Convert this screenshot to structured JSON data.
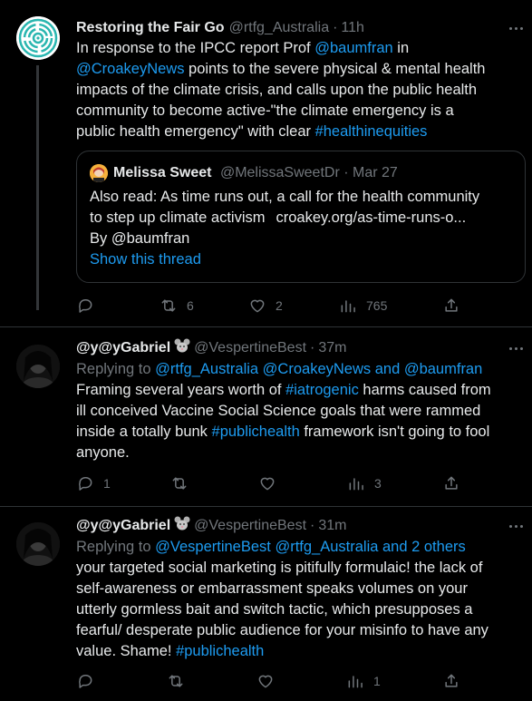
{
  "tweets": [
    {
      "name": "Restoring the Fair Go",
      "handle": "@rtfg_Australia",
      "sep": "·",
      "time": "11h",
      "text": {
        "l1_a": "In response to the IPCC report Prof ",
        "l1_link": "@baumfran",
        "l1_b": " in",
        "l2_link": "@CroakeyNews",
        "l2_b": " points to the severe physical & mental health",
        "l3": "impacts of the climate crisis, and calls upon the public health",
        "l4": "community to become active-\"the climate emergency is a",
        "l5_a": "public health emergency\" with clear ",
        "l5_link": "#healthinequities"
      },
      "quote": {
        "name": "Melissa Sweet",
        "handle": "@MelissaSweetDr",
        "sep": "·",
        "date": "Mar 27",
        "line1": "Also read: As time runs out, a call for the health community",
        "line2_a": "to step up climate activism",
        "line2_b": "croakey.org/as-time-runs-o...",
        "line3": "By @baumfran",
        "show_thread": "Show this thread"
      },
      "actions": {
        "reply": "",
        "retweet": "6",
        "like": "2",
        "views": "765"
      }
    },
    {
      "name": "@y@yGabriel",
      "handle": "@VespertineBest",
      "sep": "·",
      "time": "37m",
      "replying_label": "Replying to ",
      "replying_to": "@rtfg_Australia @CroakeyNews and @baumfran",
      "text": {
        "l1_a": "Framing several years worth of ",
        "l1_link": "#iatrogenic",
        "l1_b": " harms caused from",
        "l2": "ill conceived Vaccine Social Science goals that were rammed",
        "l3_a": "inside a totally bunk ",
        "l3_link": "#publichealth",
        "l3_b": " framework isn't going to fool",
        "l4": "anyone."
      },
      "actions": {
        "reply": "1",
        "retweet": "",
        "like": "",
        "views": "3"
      }
    },
    {
      "name": "@y@yGabriel",
      "handle": "@VespertineBest",
      "sep": "·",
      "time": "31m",
      "replying_label": "Replying to ",
      "replying_to": "@VespertineBest @rtfg_Australia and 2 others",
      "text": {
        "l1": "your targeted social marketing is pitifully formulaic! the lack of",
        "l2": "self-awareness or embarrassment speaks volumes on your",
        "l3": "utterly gormless bait and switch tactic, which presupposes a",
        "l4": "fearful/ desperate public audience for your misinfo to have any",
        "l5_a": "value. Shame! ",
        "l5_link": "#publichealth"
      },
      "actions": {
        "reply": "",
        "retweet": "",
        "like": "",
        "views": "1"
      }
    }
  ],
  "icons": {
    "reply": "reply-icon",
    "retweet": "retweet-icon",
    "like": "heart-icon",
    "views": "views-icon",
    "share": "share-icon",
    "more": "more-icon",
    "emoji": "mouse-emoji"
  },
  "colors": {
    "background": "#000000",
    "text": "#e7e9ea",
    "muted": "#71767b",
    "link": "#1d9bf0",
    "border": "#2f3336"
  }
}
